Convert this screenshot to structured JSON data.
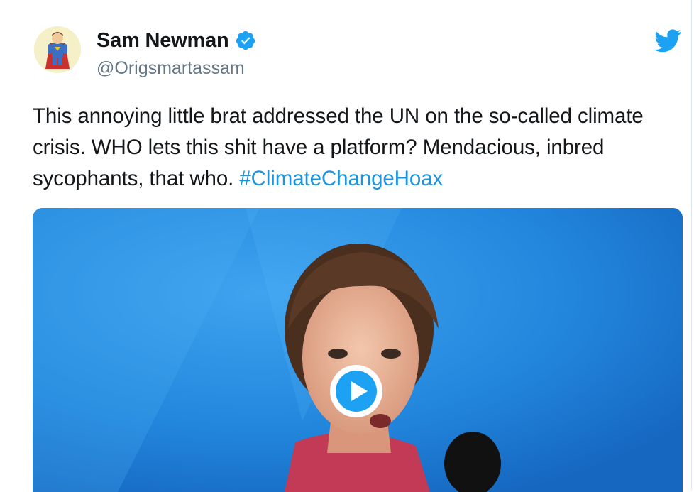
{
  "tweet": {
    "author": {
      "display_name": "Sam Newman",
      "handle": "@Origsmartassam",
      "verified": true,
      "avatar_icon": "superhero-cartoon-avatar"
    },
    "text": {
      "main": "This annoying little brat addressed the UN on the so-called climate crisis. WHO lets this shit have a platform? Mendacious, inbred sycophants, that who. ",
      "hashtag": "#ClimateChangeHoax"
    },
    "media": {
      "type": "video",
      "play_icon": "play-icon"
    }
  },
  "brand": {
    "logo_icon": "twitter-bird-icon",
    "twitter_blue": "#1da1f2",
    "link_blue": "#1b95e0"
  }
}
